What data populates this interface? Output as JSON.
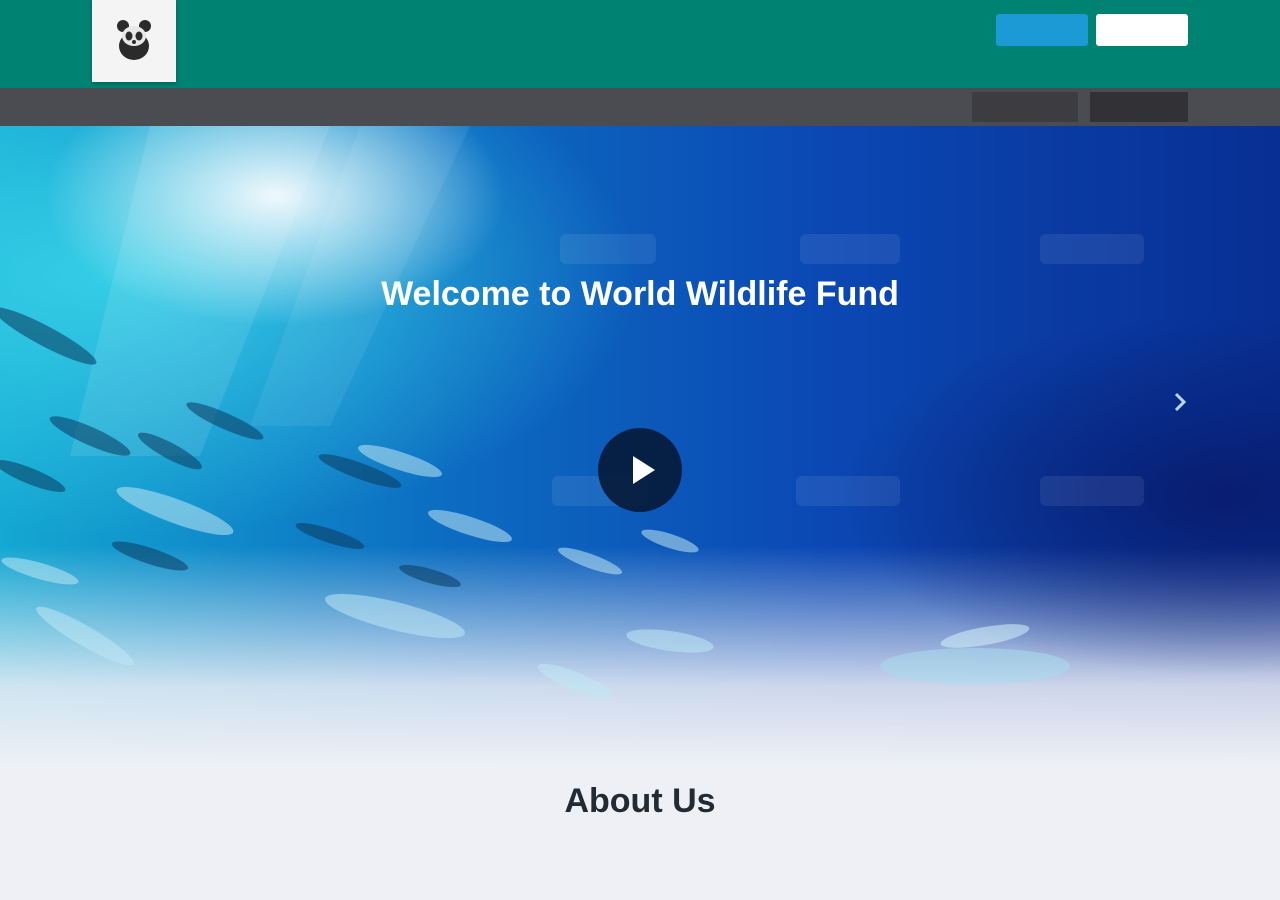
{
  "colors": {
    "header_bg": "#008272",
    "subbar_bg": "#4b4b52",
    "primary_button": "#1b9ad6",
    "secondary_button": "#ffffff",
    "hero_blue": "#0b48b4"
  },
  "header": {
    "logo_icon": "panda-logo-icon",
    "top_link": "",
    "primary_button_label": "",
    "secondary_button_label": "",
    "nav_items": [
      {
        "label": ""
      },
      {
        "label": ""
      },
      {
        "label": ""
      },
      {
        "label": ""
      },
      {
        "label": ""
      },
      {
        "label": ""
      },
      {
        "label": ""
      }
    ]
  },
  "subbar": {
    "left_text": ""
  },
  "hero": {
    "title": "Welcome to World Wildlife Fund",
    "description": "",
    "play_icon": "play-icon",
    "next_icon": "chevron-right-icon"
  },
  "about": {
    "title": "About Us",
    "text": ""
  }
}
